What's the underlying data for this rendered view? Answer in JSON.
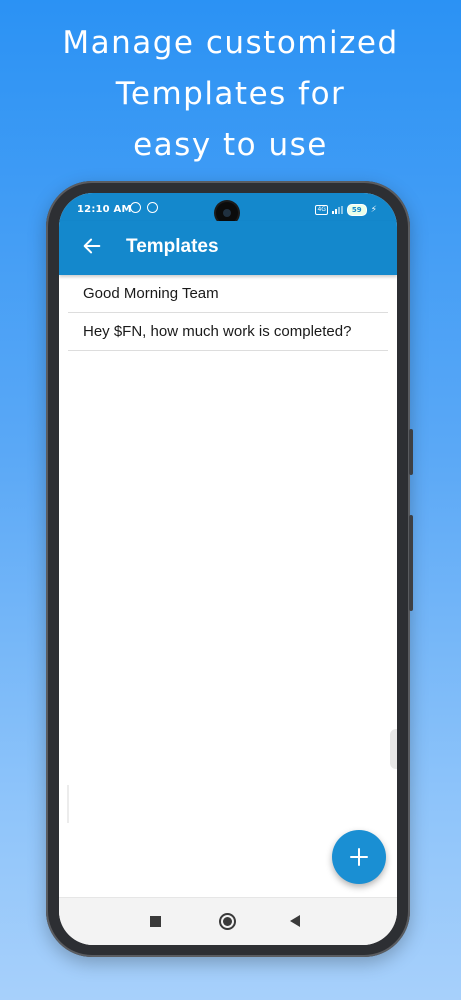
{
  "promo": {
    "line1": "Manage customized",
    "line2": "Templates for",
    "line3": "easy to use"
  },
  "status_bar": {
    "time": "12:10 AM",
    "network_label": "4G",
    "battery": "59"
  },
  "app_bar": {
    "title": "Templates",
    "back_icon": "arrow-left-icon"
  },
  "templates": [
    {
      "text": "Good Morning Team"
    },
    {
      "text": "Hey $FN, how much work is completed?"
    }
  ],
  "fab": {
    "icon": "plus-icon"
  },
  "nav_bar": {
    "recent_icon": "square-icon",
    "home_icon": "circle-icon",
    "back_icon": "triangle-back-icon"
  },
  "colors": {
    "primary": "#1488cc",
    "fab": "#1a8fd3",
    "background_top": "#2b92f4",
    "background_bottom": "#a7d0fb"
  }
}
